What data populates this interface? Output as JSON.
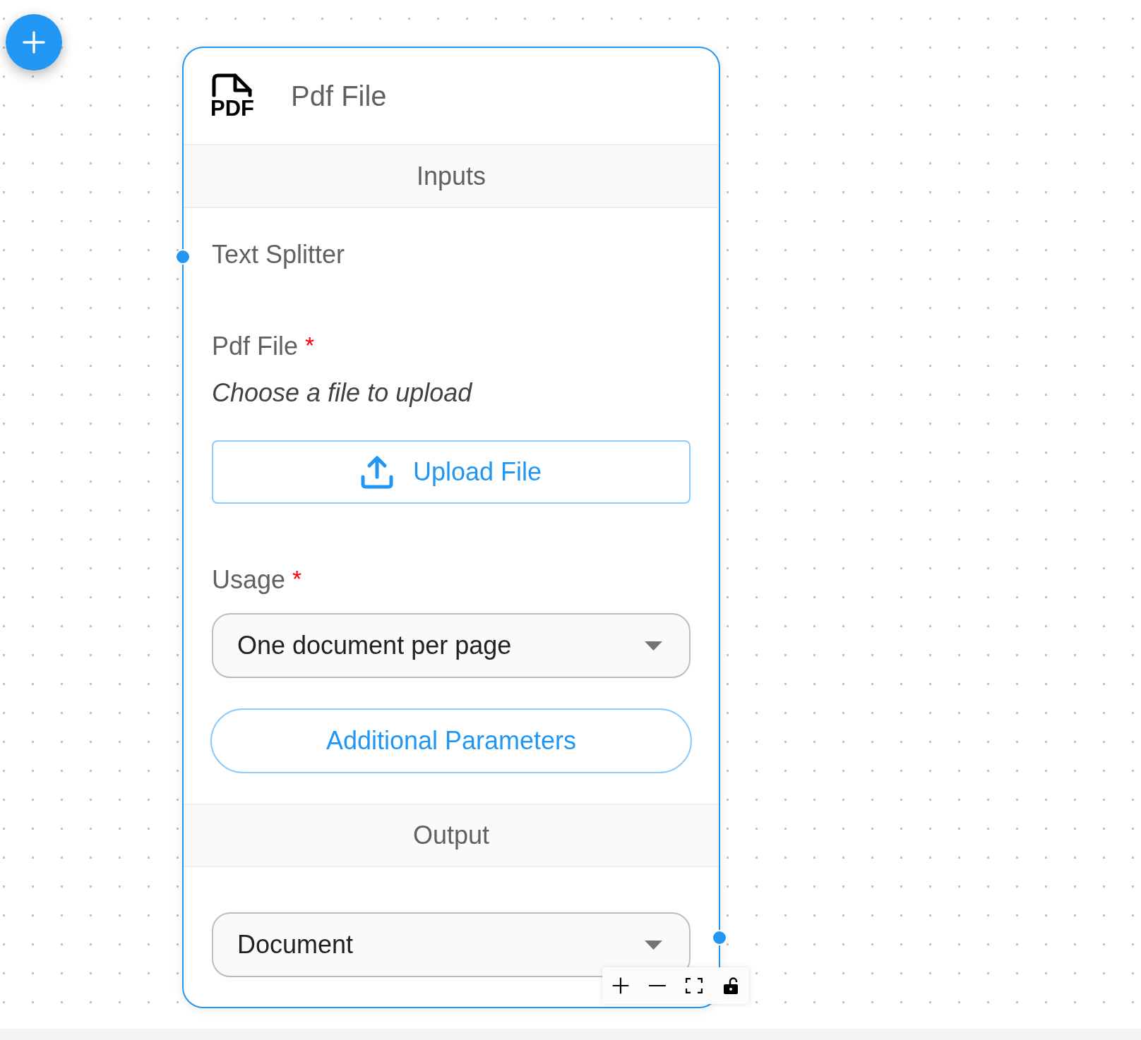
{
  "node": {
    "icon_label": "PDF",
    "title": "Pdf File",
    "inputs_heading": "Inputs",
    "anchors": [
      {
        "label": "Text Splitter"
      }
    ],
    "params": [
      {
        "kind": "file",
        "label": "Pdf File",
        "required_mark": "*",
        "hint": "Choose a file to upload",
        "button": "Upload File"
      },
      {
        "kind": "dropdown",
        "label": "Usage",
        "required_mark": "*",
        "value": "One document per page"
      }
    ],
    "additional_button": "Additional Parameters",
    "output_heading": "Output",
    "output": {
      "value": "Document"
    }
  }
}
